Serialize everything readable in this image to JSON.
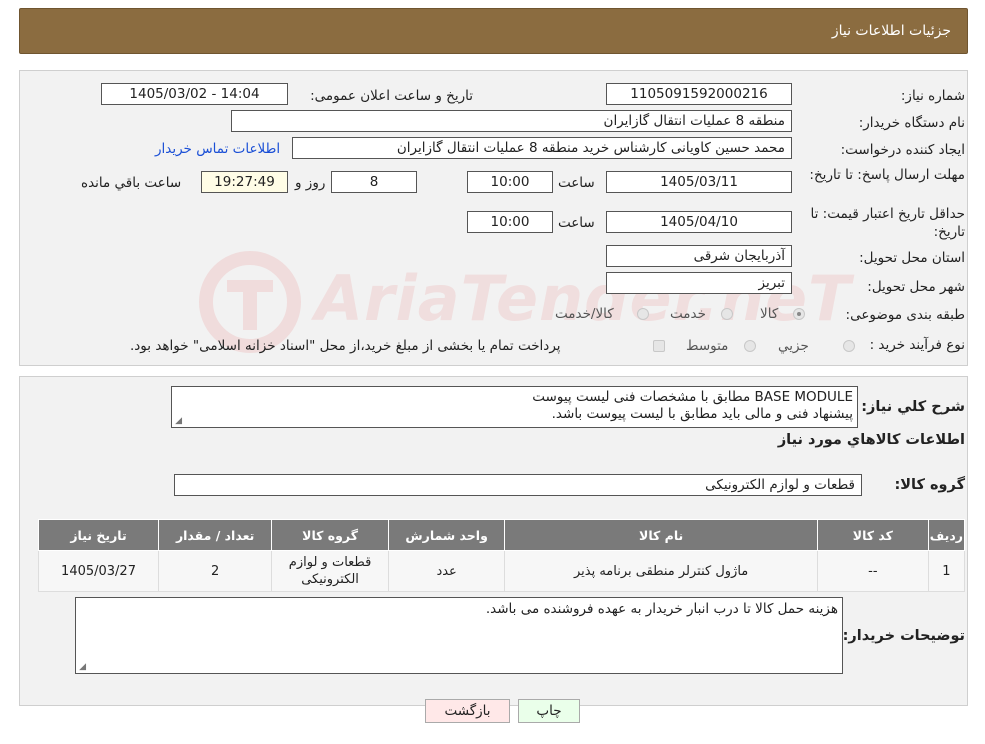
{
  "header": {
    "title": "جزئیات اطلاعات نیاز"
  },
  "watermark": "AriaTender.neT",
  "form": {
    "need_number_label": "شماره نیاز:",
    "need_number": "1105091592000216",
    "announce_label": "تاریخ و ساعت اعلان عمومی:",
    "announce_value": "1405/03/02 - 14:04",
    "buyer_org_label": "نام دستگاه خریدار:",
    "buyer_org": "منطقه 8 عملیات انتقال گازایران",
    "creator_label": "ایجاد کننده درخواست:",
    "creator": "محمد حسین کاویانی کارشناس خرید منطقه 8 عملیات انتقال گازایران",
    "contact_link": "اطلاعات تماس خریدار",
    "deadline_label": "مهلت ارسال پاسخ: تا تاریخ:",
    "deadline_date": "1405/03/11",
    "time_label": "ساعت",
    "deadline_time": "10:00",
    "days_value": "8",
    "days_label": "روز و",
    "remaining_time": "19:27:49",
    "remaining_label": "ساعت باقي مانده",
    "validity_label": "حداقل تاریخ اعتبار قیمت: تا تاریخ:",
    "validity_date": "1405/04/10",
    "validity_time": "10:00",
    "province_label": "استان محل تحویل:",
    "province": "آذربایجان شرقی",
    "city_label": "شهر محل تحویل:",
    "city": "تبریز",
    "category_label": "طبقه بندی موضوعی:",
    "category_options": [
      "کالا",
      "خدمت",
      "کالا/خدمت"
    ],
    "process_label": "نوع فرآیند خرید :",
    "process_options": [
      "جزیي",
      "متوسط"
    ],
    "process_note": "پرداخت تمام یا بخشی از مبلغ خرید،از محل \"اسناد خزانه اسلامی\" خواهد بود."
  },
  "description": {
    "label": "شرح کلي نياز:",
    "line1": "BASE MODULE مطابق با مشخصات فنی لیست پیوست",
    "line2": "پیشنهاد فنی و مالی باید مطابق با لیست پیوست باشد."
  },
  "goods_info_title": "اطلاعات کالاهاي مورد نياز",
  "goods_group_label": "گروه کالا:",
  "goods_group": "قطعات و لوازم الکترونیکی",
  "table": {
    "headers": [
      "رديف",
      "کد کالا",
      "نام کالا",
      "واحد شمارش",
      "گروه کالا",
      "تعداد / مقدار",
      "تاریخ نیاز"
    ],
    "rows": [
      [
        "1",
        "--",
        "ماژول کنترلر منطقی برنامه پذیر",
        "عدد",
        "قطعات و لوازم الکترونیکی",
        "2",
        "1405/03/27"
      ]
    ]
  },
  "buyer_notes": {
    "label": "توضیحات خریدار:",
    "text": "هزینه حمل کالا تا درب انبار خریدار به عهده فروشنده می باشد."
  },
  "buttons": {
    "print": "چاپ",
    "back": "بازگشت"
  },
  "colors": {
    "header_bg": "#8b6c40",
    "table_header_bg": "#7a7a7a",
    "link": "#1a4fd6",
    "print_btn": "#eaffea",
    "back_btn": "#ffe8e8"
  }
}
